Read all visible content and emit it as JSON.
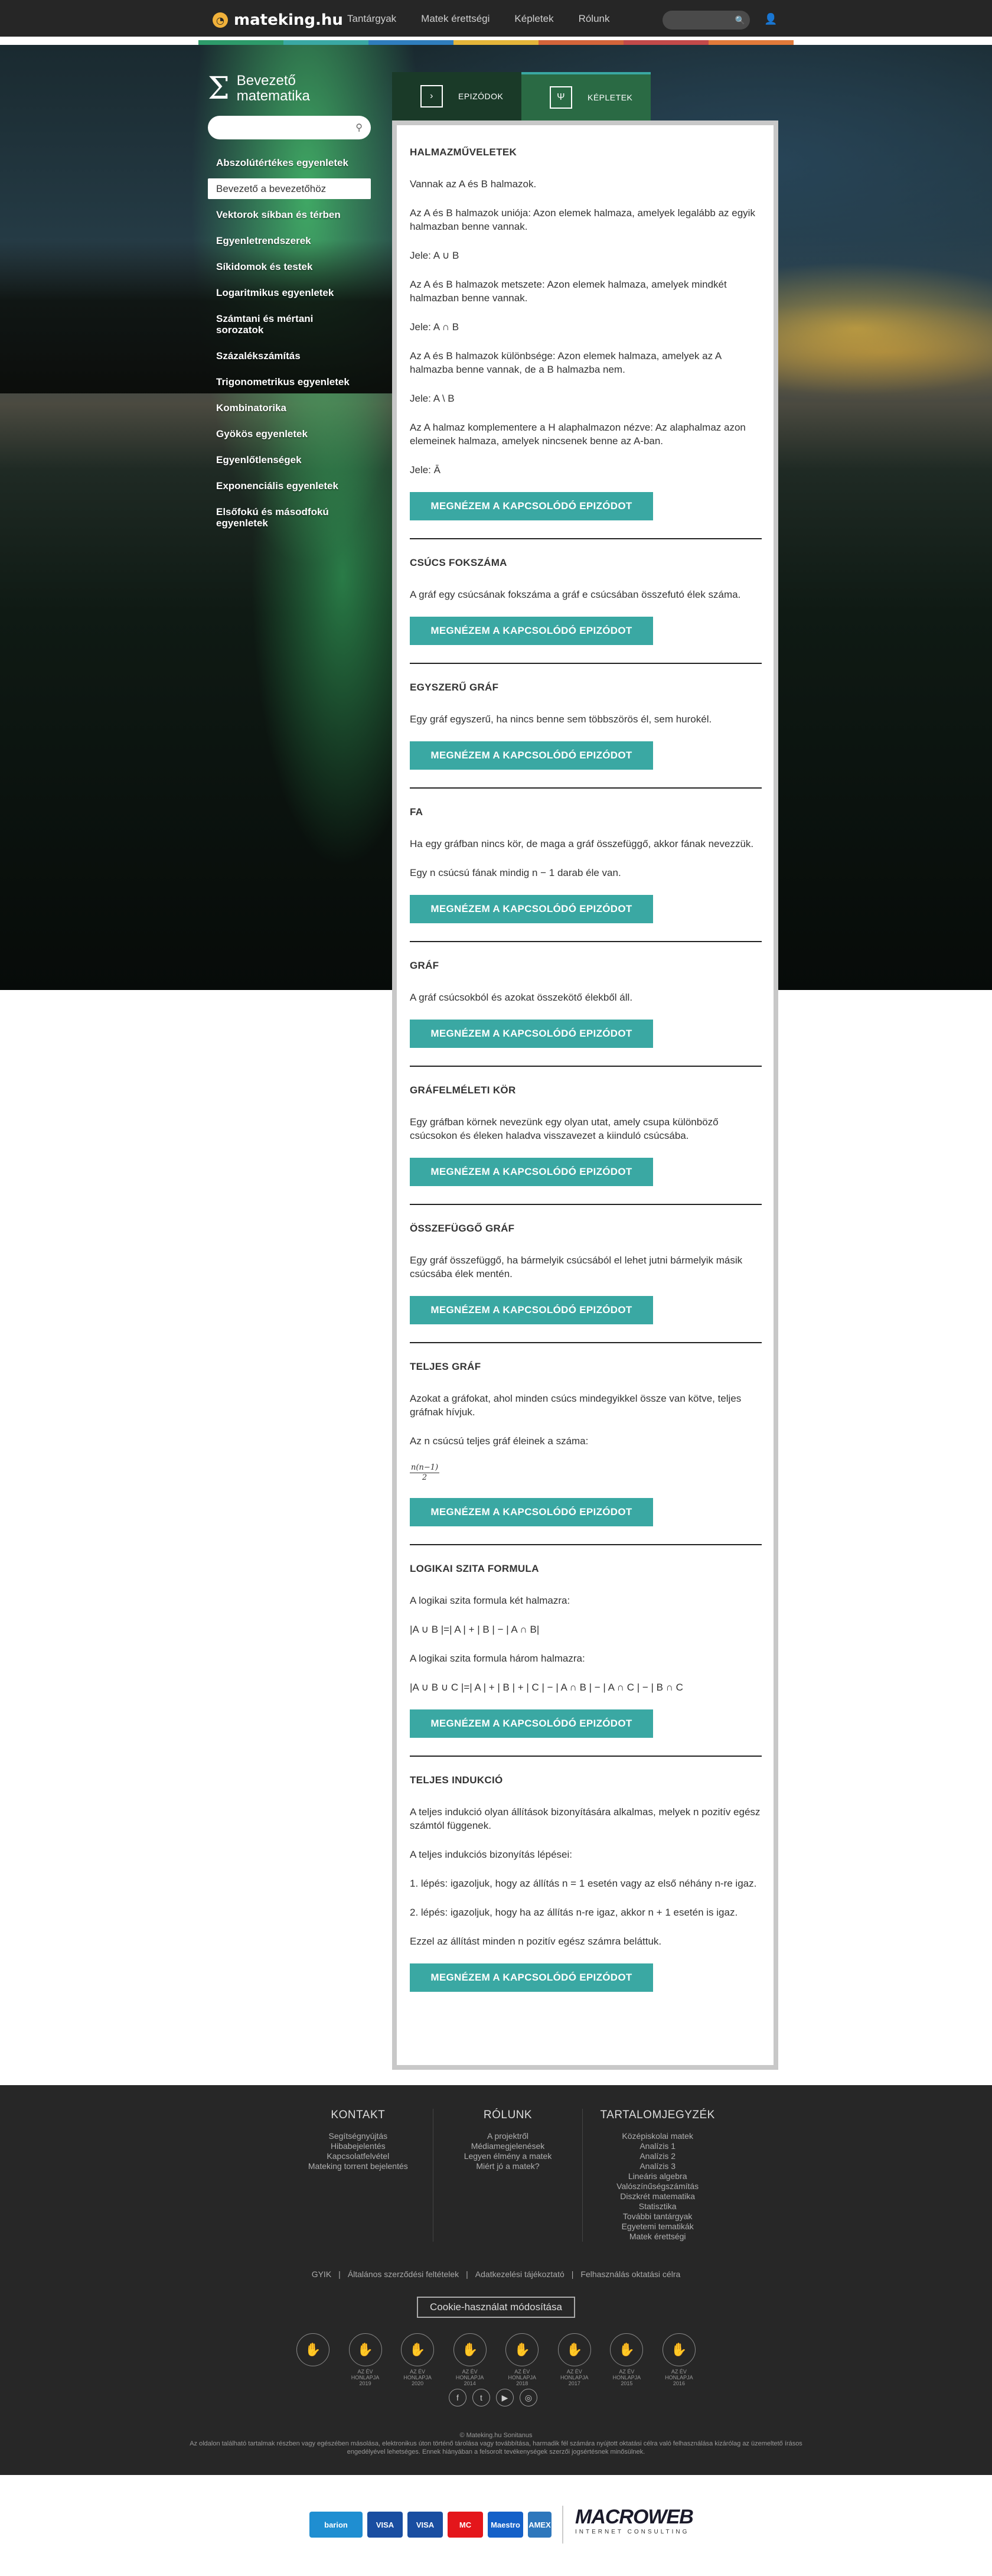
{
  "header": {
    "logo": "mateking.hu",
    "nav": [
      "Tantárgyak",
      "Matek érettségi",
      "Képletek",
      "Rólunk"
    ],
    "colors": [
      "#2d9b6a",
      "#3aa8a3",
      "#2f7dbd",
      "#e3b53a",
      "#d2643a",
      "#c24a4a",
      "#e07a3a"
    ]
  },
  "sidebar": {
    "title": "Bevezető matematika",
    "items": [
      "Abszolútértékes egyenletek",
      "Bevezető a bevezetőhöz",
      "Vektorok síkban és térben",
      "Egyenletrendszerek",
      "Síkidomok és testek",
      "Logaritmikus egyenletek",
      "Számtani és mértani sorozatok",
      "Százalékszámítás",
      "Trigonometrikus egyenletek",
      "Kombinatorika",
      "Gyökös egyenletek",
      "Egyenlőtlenségek",
      "Exponenciális egyenletek",
      "Elsőfokú és másodfokú egyenletek"
    ],
    "active_index": 1
  },
  "tabs": {
    "episodes": "EPIZÓDOK",
    "formulas": "KÉPLETEK"
  },
  "button_label": "MEGNÉZEM A KAPCSOLÓDÓ EPIZÓDOT",
  "sections": [
    {
      "title": "HALMAZMŰVELETEK",
      "paras": [
        "Vannak az A és B halmazok.",
        "Az A és B halmazok uniója: Azon elemek halmaza, amelyek legalább az egyik halmazban benne vannak.",
        "Jele: A ∪ B",
        "Az A és B halmazok metszete: Azon elemek halmaza, amelyek mindkét halmazban benne vannak.",
        "Jele: A ∩ B",
        "Az A és B halmazok különbsége: Azon elemek halmaza, amelyek az A halmazba benne vannak, de a B halmazba nem.",
        "Jele: A \\ B",
        "Az A halmaz komplementere a H alaphalmazon nézve: Az alaphalmaz azon elemeinek halmaza, amelyek nincsenek benne az A-ban.",
        "Jele: Ā"
      ]
    },
    {
      "title": "CSÚCS FOKSZÁMA",
      "paras": [
        "A gráf egy csúcsának fokszáma a gráf e csúcsában összefutó élek száma."
      ]
    },
    {
      "title": "EGYSZERŰ GRÁF",
      "paras": [
        "Egy gráf egyszerű, ha nincs benne sem többszörös él, sem hurokél."
      ]
    },
    {
      "title": "FA",
      "paras": [
        "Ha egy gráfban nincs kör, de maga a gráf összefüggő, akkor fának nevezzük.",
        "Egy n csúcsú fának mindig n − 1 darab éle van."
      ]
    },
    {
      "title": "GRÁF",
      "paras": [
        "A gráf csúcsokból és azokat összekötő élekből áll."
      ]
    },
    {
      "title": "GRÁFELMÉLETI KÖR",
      "paras": [
        "Egy gráfban körnek nevezünk egy olyan utat, amely csupa különböző csúcsokon és éleken haladva visszavezet a kiinduló csúcsába."
      ]
    },
    {
      "title": "ÖSSZEFÜGGŐ GRÁF",
      "paras": [
        "Egy gráf összefüggő, ha bármelyik csúcsából el lehet jutni bármelyik másik csúcsába élek mentén."
      ]
    },
    {
      "title": "TELJES GRÁF",
      "paras": [
        "Azokat a gráfokat, ahol minden csúcs mindegyikkel össze van kötve, teljes gráfnak hívjuk.",
        "Az n csúcsú teljes gráf éleinek a száma:"
      ],
      "frac_num": "n(n−1)",
      "frac_den": "2"
    },
    {
      "title": "LOGIKAI SZITA FORMULA",
      "paras": [
        "A logikai szita formula két halmazra:",
        "|A ∪ B |=| A | + | B | − | A ∩ B|",
        "A logikai szita formula három halmazra:",
        "|A ∪ B ∪ C |=| A | + | B | + | C | − | A ∩ B | − | A ∩ C | − | B ∩ C"
      ]
    },
    {
      "title": "TELJES INDUKCIÓ",
      "paras": [
        "A teljes indukció olyan állítások bizonyítására alkalmas, melyek n pozitív egész számtól függenek.",
        "A teljes indukciós bizonyítás lépései:",
        "1. lépés: igazoljuk, hogy az állítás n = 1 esetén vagy az első néhány n-re igaz.",
        "2. lépés: igazoljuk, hogy ha az állítás n-re igaz, akkor n + 1 esetén is igaz.",
        "Ezzel az állítást minden n pozitív egész számra beláttuk."
      ]
    }
  ],
  "footer": {
    "cols": [
      {
        "title": "KONTAKT",
        "links": [
          "Segítségnyújtás",
          "Hibabejelentés",
          "Kapcsolatfelvétel",
          "Mateking torrent bejelentés"
        ]
      },
      {
        "title": "RÓLUNK",
        "links": [
          "A projektről",
          "Médiamegjelenések",
          "Legyen élmény a matek",
          "Miért jó a matek?"
        ]
      },
      {
        "title": "TARTALOMJEGYZÉK",
        "links": [
          "Középiskolai matek",
          "Analízis 1",
          "Analízis 2",
          "Analízis 3",
          "Lineáris algebra",
          "Valószínűségszámítás",
          "Diszkrét matematika",
          "Statisztika",
          "További tantárgyak",
          "Egyetemi tematikák",
          "Matek érettségi"
        ]
      }
    ],
    "links": [
      "GYIK",
      "Általános szerződési feltételek",
      "Adatkezelési tájékoztató",
      "Felhasználás oktatási célra"
    ],
    "cookie": "Cookie-használat módosítása",
    "awards": [
      "",
      "AZ ÉV HONLAPJA 2019",
      "AZ ÉV HONLAPJA 2020",
      "AZ ÉV HONLAPJA 2014",
      "AZ ÉV HONLAPJA 2018",
      "AZ ÉV HONLAPJA 2017",
      "AZ ÉV HONLAPJA 2015",
      "AZ ÉV HONLAPJA 2016"
    ],
    "copyright": "© Mateking.hu Sonitanus",
    "notice": "Az oldalon található tartalmak részben vagy egészében másolása, elektronikus úton történő tárolása vagy továbbítása, harmadik fél számára nyújtott oktatási célra való felhasználása kizárólag az üzemeltető írásos engedélyével lehetséges. Ennek hiányában a felsorolt tevékenységek szerzői jogsértésnek minősülnek."
  },
  "payment": {
    "cards": [
      "barion",
      "VISA",
      "VISA",
      "MC",
      "Maestro",
      "AMEX"
    ],
    "company": "MACROWEB",
    "company_sub": "INTERNET CONSULTING"
  }
}
